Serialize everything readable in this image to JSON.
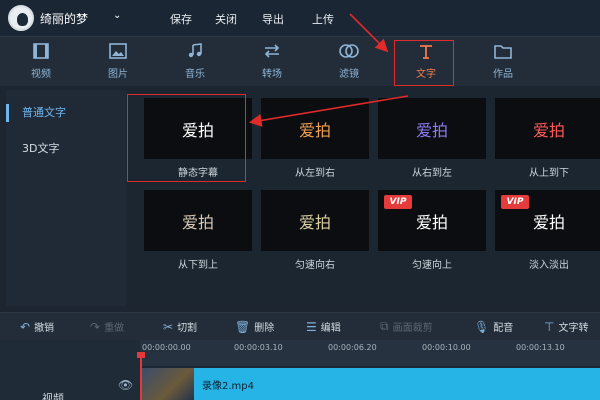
{
  "user": {
    "name": "绮丽的梦",
    "chevron": "⌄"
  },
  "top_menu": [
    "保存",
    "关闭",
    "导出",
    "上传"
  ],
  "tabs": [
    {
      "label": "视频",
      "icon": "film-icon"
    },
    {
      "label": "图片",
      "icon": "image-icon"
    },
    {
      "label": "音乐",
      "icon": "music-note-icon"
    },
    {
      "label": "转场",
      "icon": "transition-arrows-icon"
    },
    {
      "label": "滤镜",
      "icon": "filter-circles-icon"
    },
    {
      "label": "文字",
      "icon": "text-t-icon",
      "active": true
    },
    {
      "label": "作品",
      "icon": "folder-icon"
    }
  ],
  "sidebar": {
    "items": [
      {
        "label": "普通文字",
        "active": true
      },
      {
        "label": "3D文字",
        "active": false
      }
    ]
  },
  "cards": [
    {
      "text": "爱拍",
      "caption": "静态字幕",
      "color": "#ffffff",
      "vip": false
    },
    {
      "text": "爱拍",
      "caption": "从左到右",
      "color": "#f0a050",
      "vip": false
    },
    {
      "text": "爱拍",
      "caption": "从右到左",
      "color": "#8b7cf0",
      "vip": false
    },
    {
      "text": "爱拍",
      "caption": "从上到下",
      "color": "#ff5a5a",
      "vip": false
    },
    {
      "text": "爱拍",
      "caption": "从下到上",
      "color": "#d8c9b8",
      "vip": false
    },
    {
      "text": "爱拍",
      "caption": "匀速向右",
      "color": "#d9cfa0",
      "vip": false
    },
    {
      "text": "爱拍",
      "caption": "匀速向上",
      "color": "#ffffff",
      "vip": true
    },
    {
      "text": "爱拍",
      "caption": "淡入淡出",
      "color": "#ffffff",
      "vip": true
    }
  ],
  "vip_label": "VIP",
  "toolbar": [
    {
      "label": "撤销",
      "icon": "undo-icon",
      "enabled": true
    },
    {
      "label": "重做",
      "icon": "redo-icon",
      "enabled": false
    },
    {
      "label": "切割",
      "icon": "scissors-icon",
      "enabled": true
    },
    {
      "label": "删除",
      "icon": "trash-icon",
      "enabled": true
    },
    {
      "label": "编辑",
      "icon": "edit-list-icon",
      "enabled": true
    },
    {
      "label": "画面裁剪",
      "icon": "crop-icon",
      "enabled": false
    },
    {
      "label": "配音",
      "icon": "microphone-icon",
      "enabled": true
    },
    {
      "label": "文字转",
      "icon": "text-convert-icon",
      "enabled": true
    }
  ],
  "timeline": {
    "ticks": [
      "00:00:00.00",
      "00:00:03.10",
      "00:00:06.20",
      "00:00:10.00",
      "00:00:13.10"
    ],
    "clip_name": "录像2.mp4",
    "track_label": "视频"
  }
}
